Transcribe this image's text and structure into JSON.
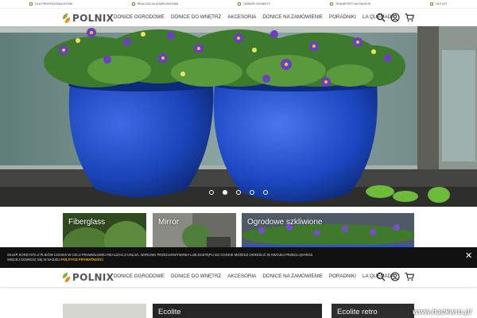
{
  "infobar": {
    "items": [
      "DLA PROFESJONALISTÓW",
      "REALIZACJA KOMPLEKSOWA",
      "ODBIÓR OSOBISTY",
      "TRANSPORT NA PALECIE",
      "OUTLET"
    ]
  },
  "header": {
    "logo_text": "POLNIX",
    "nav": [
      "DONICE OGRODOWE",
      "DONICE DO WNĘTRZ",
      "AKCESORIA",
      "DONICE NA ZAMÓWIENIE",
      "PORADNIKI",
      "LA QUEMADA"
    ],
    "icons": [
      "search-icon",
      "account-icon",
      "cart-icon"
    ]
  },
  "hero": {
    "slides": 5,
    "active_slide": 2
  },
  "tiles": {
    "row1": [
      "Fiberglass",
      "Mirror",
      "Ogrodowe szkliwione"
    ],
    "row2": [
      "",
      "Ecolite",
      "Ecolite retro"
    ]
  },
  "cookie": {
    "text": "SKLEP KORZYSTA Z PLIKÓW COOKIE W CELU PRAWIDŁOWEJ REALIZACJI USŁUG. WARUNKI PRZECHOWYWANIA LUB DOSTĘPU DO COOKIE MOŻESZ OKREŚLIĆ W SWOJEJ PRZEGLĄDARCE.",
    "text2": "WIĘCEJ DOWIESZ SIĘ W NASZEJ",
    "link": "POLITYCE PRYWATNOŚCI",
    "close": "✕"
  },
  "watermark": "www.hackwro.pl",
  "colors": {
    "accent_green": "#7fb241",
    "accent_orange": "#e88a1a",
    "pot_blue": "#1a44b8",
    "cookie_link": "#f2b623"
  }
}
